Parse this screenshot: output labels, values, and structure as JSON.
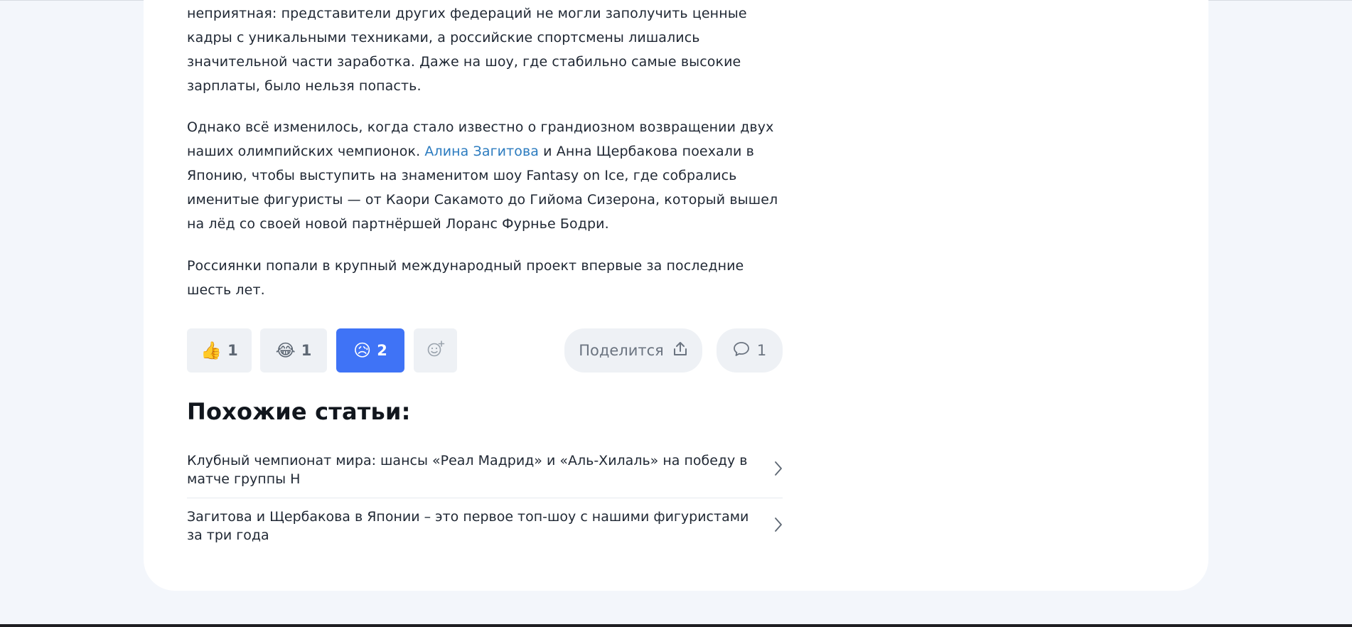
{
  "article": {
    "p1": "неприятная: представители других федераций не могли заполучить ценные кадры с уникальными техниками, а российские спортсмены лишались значительной части заработка. Даже на шоу, где стабильно самые высокие зарплаты, было нельзя попасть.",
    "p2_before": "Однако всё изменилось, когда стало известно о грандиозном возвращении двух наших олимпийских чемпионок. ",
    "p2_link": "Алина Загитова",
    "p2_after": " и Анна Щербакова поехали в Японию, чтобы выступить на знаменитом шоу Fantasy on Ice, где собрались именитые фигуристы — от Каори Сакамото до Гийома Сизерона, который вышел на лёд со своей новой партнёршей Лоранс Фурнье Бодри.",
    "p3": "Россиянки попали в крупный международный проект впервые за последние шесть лет."
  },
  "reactions": {
    "thumbs_emoji": "👍",
    "thumbs_count": "1",
    "laugh_emoji": "😂",
    "laugh_count": "1",
    "sad_emoji": "😥",
    "sad_count": "2",
    "add_icon": "add-reaction-icon",
    "active_color": "#3f73f6"
  },
  "share": {
    "label": "Поделится",
    "icon": "share-upload-icon"
  },
  "comments": {
    "count": "1",
    "icon": "comment-bubble-icon"
  },
  "similar": {
    "title": "Похожие статьи:",
    "items": [
      {
        "text": "Клубный чемпионат мира: шансы «Реал Мадрид» и «Аль-Хилаль» на победу в матче группы H"
      },
      {
        "text": "Загитова и Щербакова в Японии – это первое топ-шоу с нашими фигуристами за три года"
      }
    ]
  },
  "colors": {
    "link": "#2b7bbf",
    "page_bg": "#f3f6fb",
    "card_bg": "#ffffff"
  }
}
